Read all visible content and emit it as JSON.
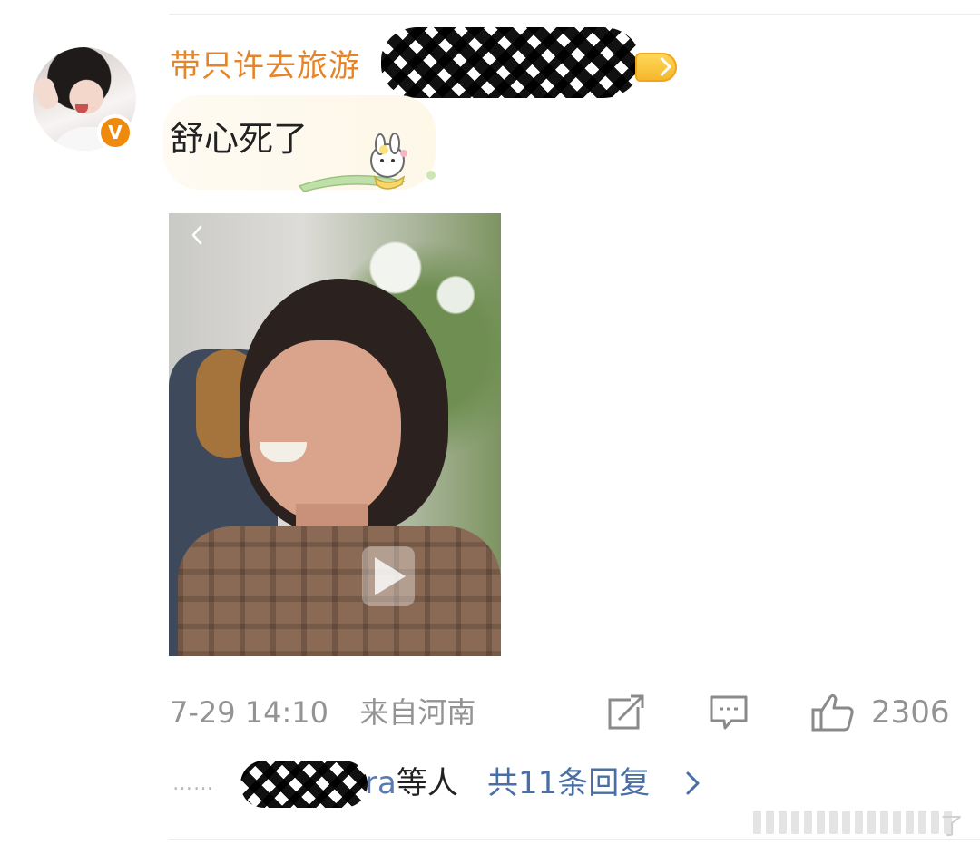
{
  "post": {
    "username": "带只许去旅游",
    "verified_badge": "V",
    "text": "舒心死了",
    "timestamp": "7-29 14:10",
    "location": "来自河南",
    "like_count": "2306"
  },
  "replies": {
    "leading_dots": "……",
    "users_visible_fragment": "ra",
    "users_suffix": "等人",
    "count_label": "共11条回复"
  },
  "watermark": {
    "text": "了"
  },
  "icons": {
    "share": "share-icon",
    "comment": "comment-icon",
    "like": "like-icon",
    "back": "back-arrow-icon",
    "play": "play-icon",
    "chevron": "chevron-right-icon"
  },
  "colors": {
    "username": "#e5852a",
    "verified": "#f08a0c",
    "link": "#4a6fa5",
    "meta": "#939393"
  }
}
